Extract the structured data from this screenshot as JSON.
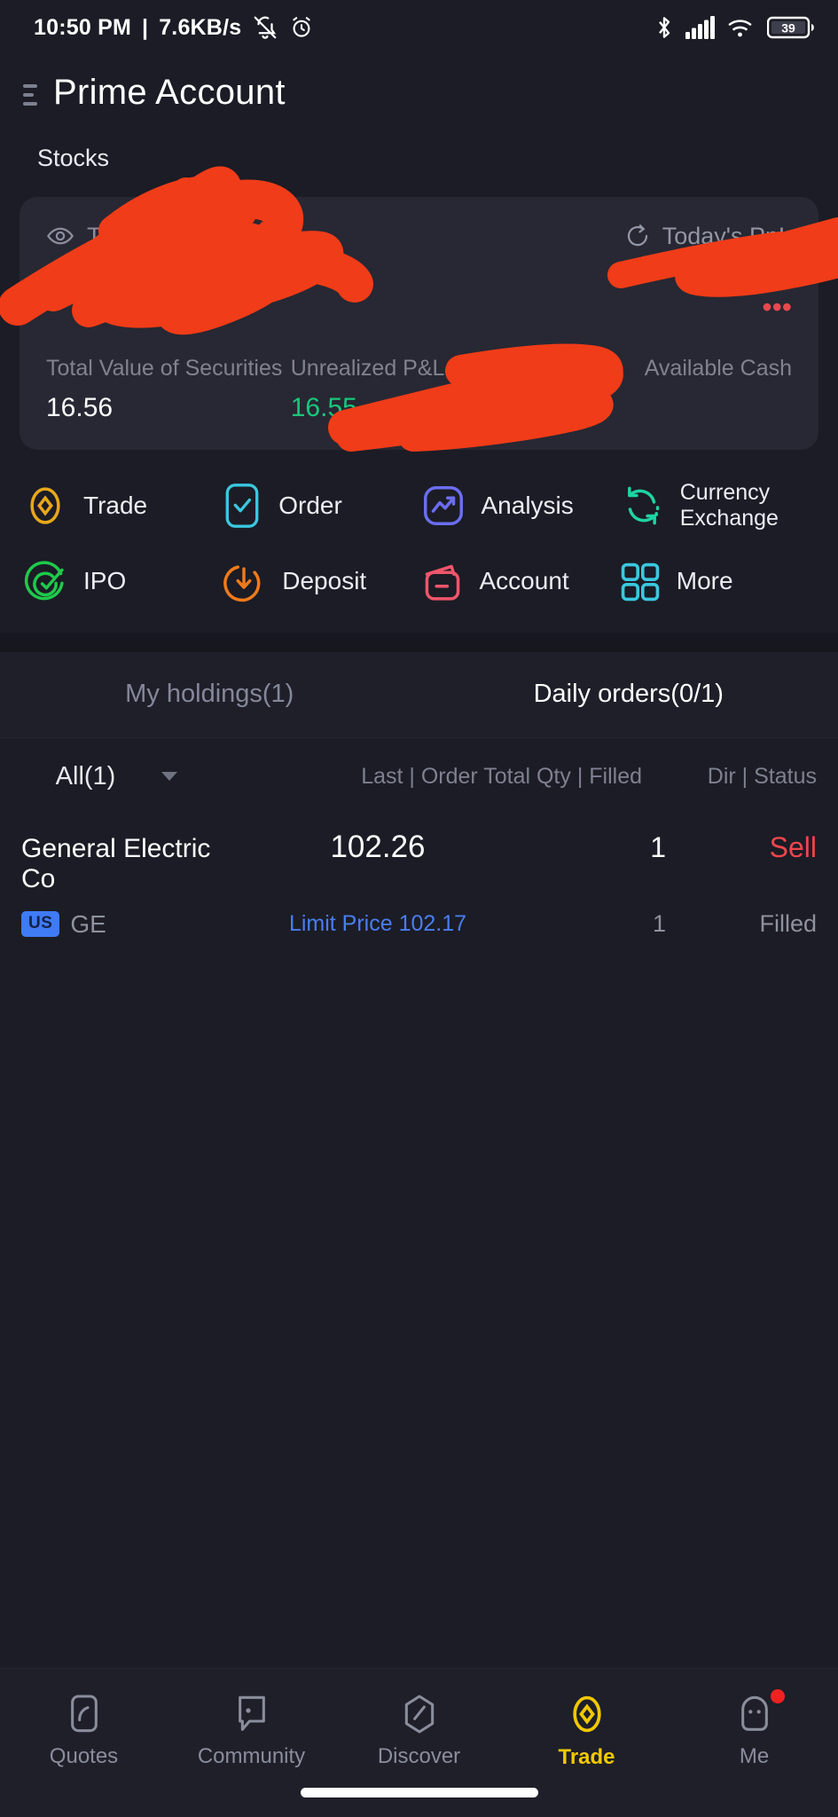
{
  "statusbar": {
    "time": "10:50 PM",
    "separator": "|",
    "network_speed": "7.6KB/s",
    "mute_icon": "bell-muted-icon",
    "alarm_icon": "alarm-clock-icon",
    "bluetooth_icon": "bluetooth-icon",
    "signal_icon": "cellular-signal-icon",
    "wifi_icon": "wifi-icon",
    "battery_level": "39"
  },
  "header": {
    "menu_icon": "hamburger-menu-icon",
    "title": "Prime Account"
  },
  "section": {
    "label": "Stocks"
  },
  "balance_card": {
    "eye_icon": "eye-visible-icon",
    "assets_label": "Total Assets USD",
    "assets_caret": "chevron-down-icon",
    "refresh_icon": "refresh-icon",
    "pnl_label": "Today's PnL",
    "balance_value": "",
    "pnl_value": "",
    "redacted_note": "values obscured by red scribble annotation",
    "stats": [
      {
        "label": "Total Value of Securities",
        "value": "16.56",
        "color": "#ffffff"
      },
      {
        "label": "Unrealized P&L(USD)",
        "value": "16.55",
        "color": "#19c77d"
      },
      {
        "label": "Available Cash",
        "value": "",
        "color": "#ffffff"
      }
    ]
  },
  "quick_actions": {
    "row1": [
      {
        "label": "Trade",
        "icon": "trade-diamond-icon",
        "color": "#e8a71b"
      },
      {
        "label": "Order",
        "icon": "order-checklist-icon",
        "color": "#3ac8e0"
      },
      {
        "label": "Analysis",
        "icon": "analysis-chart-icon",
        "color": "#6b6ef0"
      },
      {
        "label": "Currency Exchange",
        "icon": "currency-exchange-icon",
        "color": "#1fd3a3"
      }
    ],
    "row2": [
      {
        "label": "IPO",
        "icon": "ipo-target-icon",
        "color": "#1fc94a"
      },
      {
        "label": "Deposit",
        "icon": "deposit-arrow-icon",
        "color": "#ef7a1b"
      },
      {
        "label": "Account",
        "icon": "account-wallet-icon",
        "color": "#f0556b"
      },
      {
        "label": "More",
        "icon": "more-grid-icon",
        "color": "#3ac8e0"
      }
    ]
  },
  "tabs": [
    {
      "label": "My holdings(1)",
      "active": false
    },
    {
      "label": "Daily orders(0/1)",
      "active": true
    }
  ],
  "table": {
    "filter_label": "All(1)",
    "filter_caret": "chevron-down-icon",
    "headers_mid": "Last | Order Total Qty | Filled",
    "headers_right": "Dir | Status",
    "rows": [
      {
        "name": "General Electric Co",
        "market_badge": "US",
        "symbol": "GE",
        "last_price": "102.26",
        "order_type": "Limit Price 102.17",
        "qty_total": "1",
        "qty_filled": "1",
        "direction": "Sell",
        "status": "Filled"
      }
    ]
  },
  "bottom_nav": [
    {
      "label": "Quotes",
      "icon": "quotes-phone-icon",
      "active": false,
      "badge": false
    },
    {
      "label": "Community",
      "icon": "community-chat-icon",
      "active": false,
      "badge": false
    },
    {
      "label": "Discover",
      "icon": "discover-compass-icon",
      "active": false,
      "badge": false
    },
    {
      "label": "Trade",
      "icon": "trade-diamond-icon",
      "active": true,
      "badge": false
    },
    {
      "label": "Me",
      "icon": "me-avatar-icon",
      "active": false,
      "badge": true
    }
  ],
  "colors": {
    "page_bg": "#1b1c25",
    "card_bg": "#272833",
    "accent_yellow": "#f0c419",
    "positive_green": "#19c77d",
    "negative_red": "#f0454f",
    "link_blue": "#4a7df0",
    "scribble_red": "#F03C18"
  }
}
